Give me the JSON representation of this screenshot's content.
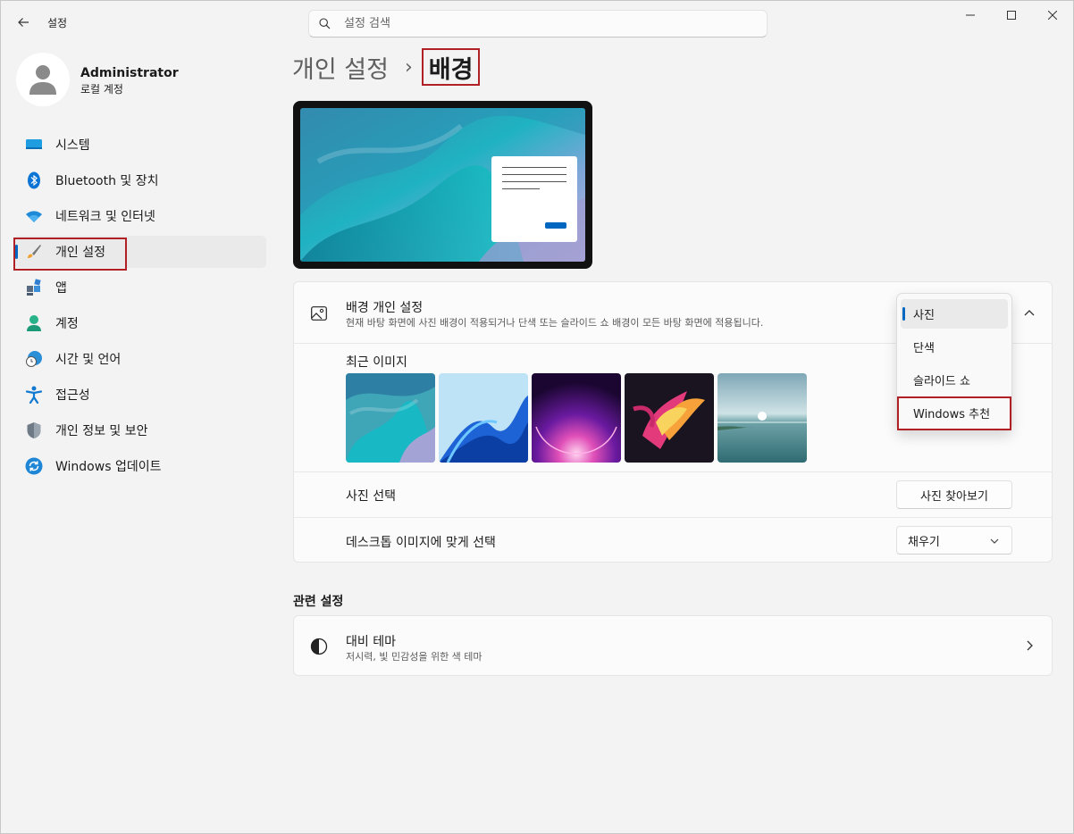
{
  "window": {
    "app_title": "설정",
    "search_placeholder": "설정 검색"
  },
  "user": {
    "name": "Administrator",
    "account_type": "로컬 계정"
  },
  "sidebar": {
    "items": [
      {
        "label": "시스템",
        "icon": "system-icon"
      },
      {
        "label": "Bluetooth 및 장치",
        "icon": "bluetooth-icon"
      },
      {
        "label": "네트워크 및 인터넷",
        "icon": "wifi-icon"
      },
      {
        "label": "개인 설정",
        "icon": "brush-icon",
        "active": true
      },
      {
        "label": "앱",
        "icon": "apps-icon"
      },
      {
        "label": "계정",
        "icon": "account-icon"
      },
      {
        "label": "시간 및 언어",
        "icon": "clock-globe-icon"
      },
      {
        "label": "접근성",
        "icon": "accessibility-icon"
      },
      {
        "label": "개인 정보 및 보안",
        "icon": "shield-icon"
      },
      {
        "label": "Windows 업데이트",
        "icon": "update-icon"
      }
    ]
  },
  "breadcrumb": {
    "parent": "개인 설정",
    "separator": "›",
    "current": "배경"
  },
  "background_card": {
    "title": "배경 개인 설정",
    "description": "현재 바탕 화면에 사진 배경이 적용되거나 단색 또는 슬라이드 쇼 배경이 모든 바탕 화면에 적용됩니다.",
    "recent_images_label": "최근 이미지",
    "choose_photo_label": "사진 선택",
    "browse_button": "사진 찾아보기",
    "fit_label": "데스크톱 이미지에 맞게 선택",
    "fit_value": "채우기"
  },
  "dropdown": {
    "options": [
      "사진",
      "단색",
      "슬라이드 쇼",
      "Windows 추천"
    ],
    "selected": "사진"
  },
  "related": {
    "section_title": "관련 설정",
    "contrast_title": "대비 테마",
    "contrast_sub": "저시력, 빛 민감성을 위한 색 테마"
  },
  "colors": {
    "accent": "#0067c0",
    "highlight_box": "#b02025",
    "background": "#f3f3f3",
    "card": "#fbfbfb"
  }
}
